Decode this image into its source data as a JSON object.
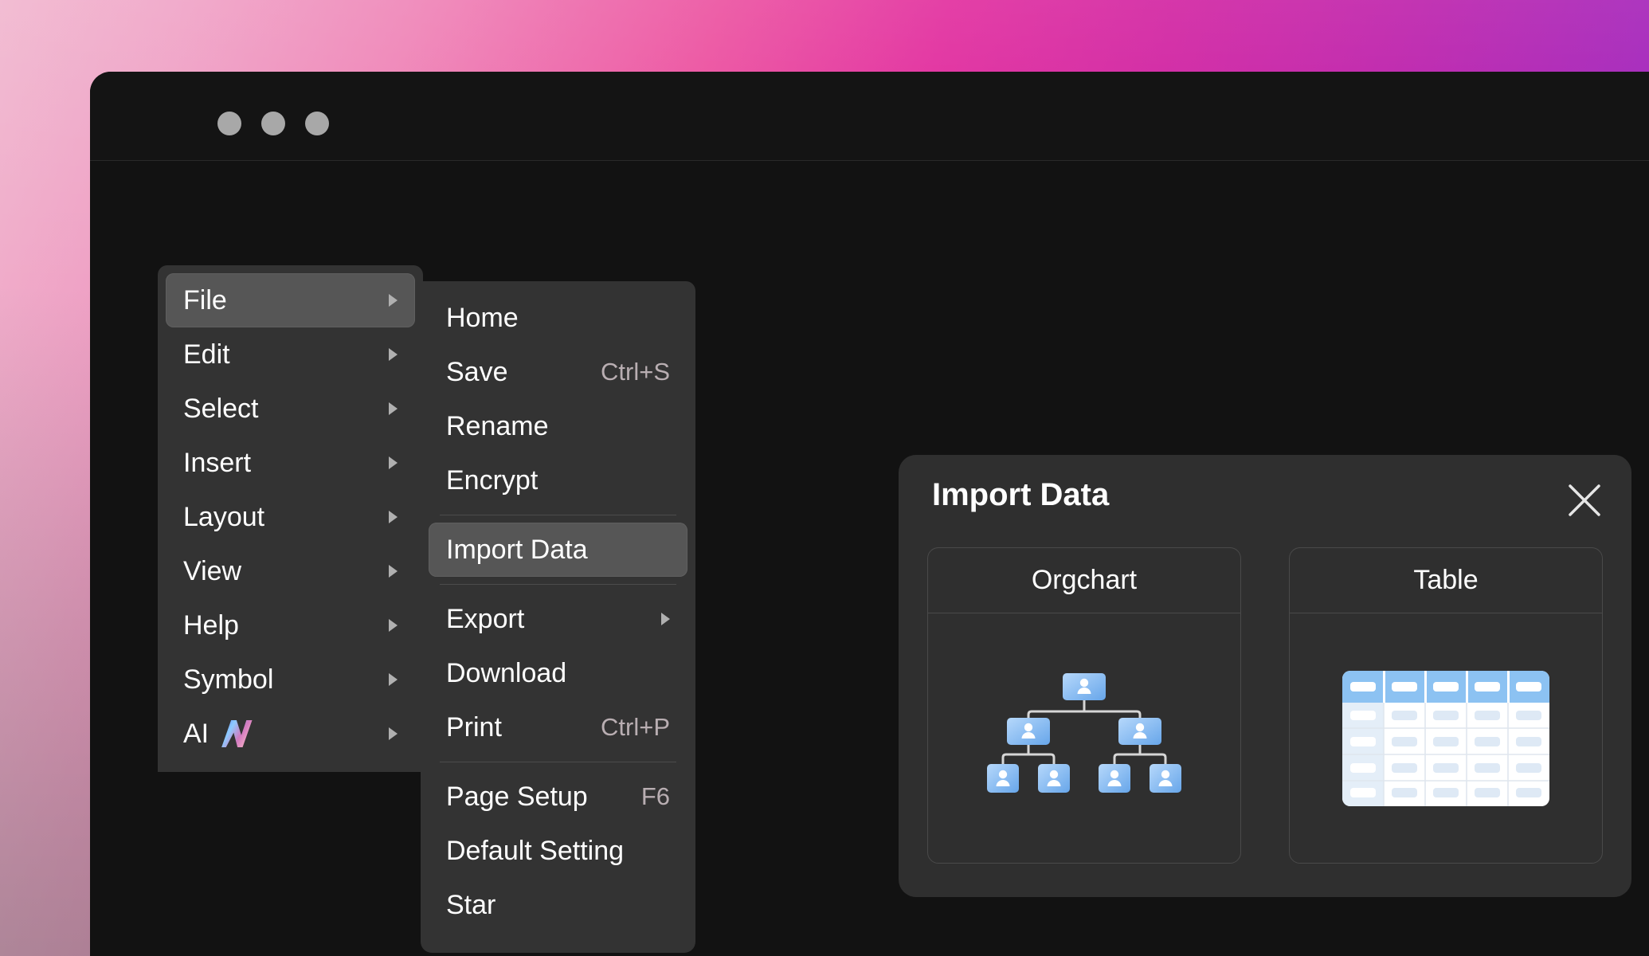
{
  "window": {
    "traffic_lights": [
      "close-dot",
      "minimize-dot",
      "maximize-dot"
    ],
    "background_colors": {
      "gradient_start": "#f0b4cd",
      "gradient_mid": "#e0259a",
      "gradient_end": "#8b22c4",
      "window_bg": "#121212",
      "titlebar_bg": "#141414",
      "menu_bg": "#333333",
      "menu_highlight": "#565656",
      "dialog_bg": "#2f2f2f",
      "accent_blue": "#7fb5f0"
    }
  },
  "menu_root": {
    "name": "main-menu",
    "items": [
      {
        "label": "File",
        "has_submenu": true,
        "selected": true,
        "icon": ""
      },
      {
        "label": "Edit",
        "has_submenu": true,
        "selected": false,
        "icon": ""
      },
      {
        "label": "Select",
        "has_submenu": true,
        "selected": false,
        "icon": ""
      },
      {
        "label": "Insert",
        "has_submenu": true,
        "selected": false,
        "icon": ""
      },
      {
        "label": "Layout",
        "has_submenu": true,
        "selected": false,
        "icon": ""
      },
      {
        "label": "View",
        "has_submenu": true,
        "selected": false,
        "icon": ""
      },
      {
        "label": "Help",
        "has_submenu": true,
        "selected": false,
        "icon": ""
      },
      {
        "label": "Symbol",
        "has_submenu": true,
        "selected": false,
        "icon": ""
      },
      {
        "label": "AI",
        "has_submenu": true,
        "selected": false,
        "icon": "ai-sparkle-icon"
      }
    ]
  },
  "menu_file": {
    "name": "file-submenu",
    "groups": [
      {
        "items": [
          {
            "label": "Home",
            "shortcut": "",
            "has_submenu": false,
            "selected": false
          },
          {
            "label": "Save",
            "shortcut": "Ctrl+S",
            "has_submenu": false,
            "selected": false
          },
          {
            "label": "Rename",
            "shortcut": "",
            "has_submenu": false,
            "selected": false
          },
          {
            "label": "Encrypt",
            "shortcut": "",
            "has_submenu": false,
            "selected": false
          }
        ]
      },
      {
        "items": [
          {
            "label": "Import Data",
            "shortcut": "",
            "has_submenu": false,
            "selected": true
          }
        ]
      },
      {
        "items": [
          {
            "label": "Export",
            "shortcut": "",
            "has_submenu": true,
            "selected": false
          },
          {
            "label": "Download",
            "shortcut": "",
            "has_submenu": false,
            "selected": false
          },
          {
            "label": "Print",
            "shortcut": "Ctrl+P",
            "has_submenu": false,
            "selected": false
          }
        ]
      },
      {
        "items": [
          {
            "label": "Page Setup",
            "shortcut": "F6",
            "has_submenu": false,
            "selected": false
          },
          {
            "label": "Default Setting",
            "shortcut": "",
            "has_submenu": false,
            "selected": false
          },
          {
            "label": "Star",
            "shortcut": "",
            "has_submenu": false,
            "selected": false
          }
        ]
      }
    ]
  },
  "dialog": {
    "title": "Import Data",
    "close_icon": "close-icon",
    "options": [
      {
        "label": "Orgchart",
        "illustration": "orgchart-tree-icon"
      },
      {
        "label": "Table",
        "illustration": "table-grid-icon"
      }
    ]
  },
  "illustrations": {
    "orgchart": {
      "levels": [
        1,
        2,
        4
      ],
      "node_fill_start": "#a9d2fa",
      "node_fill_end": "#6aa9ec",
      "connector_color": "#d7d7d7"
    },
    "table": {
      "columns": 5,
      "rows": 5,
      "header_fill": "#8cc2f2",
      "first_column_fill": "#e4eef8",
      "cell_fill": "#ffffff",
      "cell_bar_fill": "#dee9f5"
    }
  }
}
